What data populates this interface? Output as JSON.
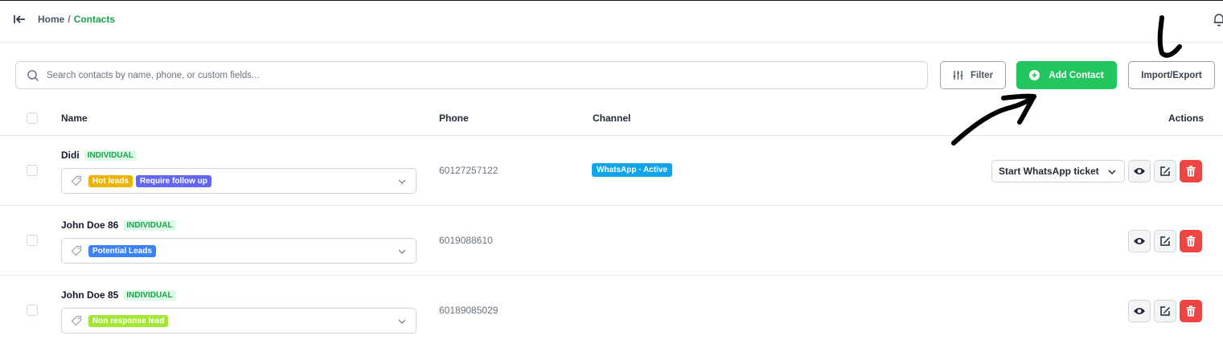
{
  "breadcrumb": {
    "home": "Home",
    "separator": "/",
    "current": "Contacts"
  },
  "search": {
    "placeholder": "Search contacts by name, phone, or custom fields...",
    "value": ""
  },
  "toolbar": {
    "filter_label": "Filter",
    "add_label": "Add Contact",
    "import_label": "Import/Export"
  },
  "table": {
    "columns": {
      "name": "Name",
      "phone": "Phone",
      "channel": "Channel",
      "actions": "Actions"
    },
    "rows": [
      {
        "name": "Didi",
        "type": "INDIVIDUAL",
        "tags": [
          {
            "label": "Hot leads",
            "color": "#eab308"
          },
          {
            "label": "Require follow up",
            "color": "#6366f1"
          }
        ],
        "phone": "60127257122",
        "channel": "WhatsApp · Active",
        "ticket_action": "Start WhatsApp ticket"
      },
      {
        "name": "John Doe 86",
        "type": "INDIVIDUAL",
        "tags": [
          {
            "label": "Potential Leads",
            "color": "#3b82f6"
          }
        ],
        "phone": "6019088610"
      },
      {
        "name": "John Doe 85",
        "type": "INDIVIDUAL",
        "tags": [
          {
            "label": "Non response lead",
            "color": "#a3e635"
          }
        ],
        "phone": "60189085029"
      }
    ]
  },
  "icons": {
    "collapse": "collapse-sidebar-icon",
    "bell": "bell-icon",
    "search": "search-icon",
    "filter": "sliders-icon",
    "add": "plus-circle-icon",
    "tag": "tag-icon",
    "view": "eye-icon",
    "edit": "edit-icon",
    "delete": "trash-icon"
  },
  "colors": {
    "accent": "#22c55e",
    "breadcrumb_active": "#16a34a",
    "channel_badge": "#0ea5e9",
    "delete": "#ef4444"
  }
}
